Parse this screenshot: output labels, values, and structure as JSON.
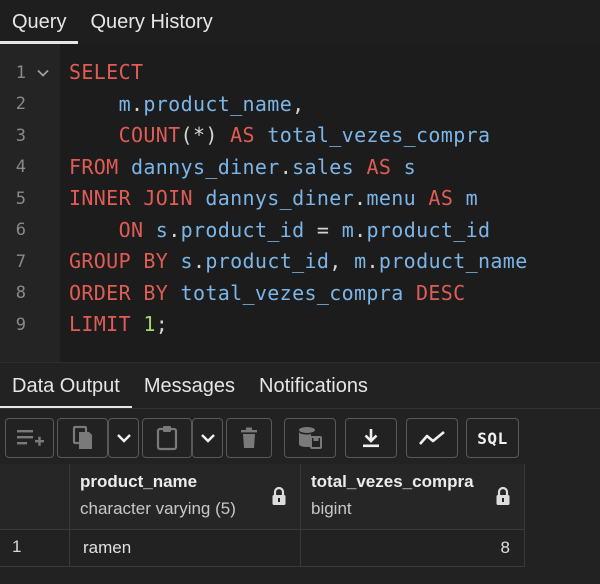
{
  "query_tabs": [
    {
      "label": "Query",
      "active": true
    },
    {
      "label": "Query History",
      "active": false
    }
  ],
  "editor": {
    "line_numbers": [
      "1",
      "2",
      "3",
      "4",
      "5",
      "6",
      "7",
      "8",
      "9"
    ],
    "lines": [
      [
        {
          "t": "SELECT",
          "c": "kw"
        }
      ],
      [
        {
          "t": "    ",
          "c": "op"
        },
        {
          "t": "m",
          "c": "id"
        },
        {
          "t": ".",
          "c": "op"
        },
        {
          "t": "product_name",
          "c": "id"
        },
        {
          "t": ",",
          "c": "op"
        }
      ],
      [
        {
          "t": "    ",
          "c": "op"
        },
        {
          "t": "COUNT",
          "c": "kw"
        },
        {
          "t": "(*) ",
          "c": "op"
        },
        {
          "t": "AS",
          "c": "kw"
        },
        {
          "t": " ",
          "c": "op"
        },
        {
          "t": "total_vezes_compra",
          "c": "id"
        }
      ],
      [
        {
          "t": "FROM",
          "c": "kw"
        },
        {
          "t": " ",
          "c": "op"
        },
        {
          "t": "dannys_diner",
          "c": "id"
        },
        {
          "t": ".",
          "c": "op"
        },
        {
          "t": "sales",
          "c": "id"
        },
        {
          "t": " ",
          "c": "op"
        },
        {
          "t": "AS",
          "c": "kw"
        },
        {
          "t": " ",
          "c": "op"
        },
        {
          "t": "s",
          "c": "id"
        }
      ],
      [
        {
          "t": "INNER JOIN",
          "c": "kw"
        },
        {
          "t": " ",
          "c": "op"
        },
        {
          "t": "dannys_diner",
          "c": "id"
        },
        {
          "t": ".",
          "c": "op"
        },
        {
          "t": "menu",
          "c": "id"
        },
        {
          "t": " ",
          "c": "op"
        },
        {
          "t": "AS",
          "c": "kw"
        },
        {
          "t": " ",
          "c": "op"
        },
        {
          "t": "m",
          "c": "id"
        }
      ],
      [
        {
          "t": "    ",
          "c": "op"
        },
        {
          "t": "ON",
          "c": "kw"
        },
        {
          "t": " ",
          "c": "op"
        },
        {
          "t": "s",
          "c": "id"
        },
        {
          "t": ".",
          "c": "op"
        },
        {
          "t": "product_id",
          "c": "id"
        },
        {
          "t": " = ",
          "c": "op"
        },
        {
          "t": "m",
          "c": "id"
        },
        {
          "t": ".",
          "c": "op"
        },
        {
          "t": "product_id",
          "c": "id"
        }
      ],
      [
        {
          "t": "GROUP BY",
          "c": "kw"
        },
        {
          "t": " ",
          "c": "op"
        },
        {
          "t": "s",
          "c": "id"
        },
        {
          "t": ".",
          "c": "op"
        },
        {
          "t": "product_id",
          "c": "id"
        },
        {
          "t": ", ",
          "c": "op"
        },
        {
          "t": "m",
          "c": "id"
        },
        {
          "t": ".",
          "c": "op"
        },
        {
          "t": "product_name",
          "c": "id"
        }
      ],
      [
        {
          "t": "ORDER BY",
          "c": "kw"
        },
        {
          "t": " ",
          "c": "op"
        },
        {
          "t": "total_vezes_compra",
          "c": "id"
        },
        {
          "t": " ",
          "c": "op"
        },
        {
          "t": "DESC",
          "c": "kw"
        }
      ],
      [
        {
          "t": "LIMIT",
          "c": "kw"
        },
        {
          "t": " ",
          "c": "op"
        },
        {
          "t": "1",
          "c": "num-lit"
        },
        {
          "t": ";",
          "c": "op"
        }
      ]
    ]
  },
  "output_tabs": [
    {
      "label": "Data Output",
      "active": true
    },
    {
      "label": "Messages",
      "active": false
    },
    {
      "label": "Notifications",
      "active": false
    }
  ],
  "toolbar": {
    "sql_label": "SQL",
    "icons": [
      "add-row-icon",
      "copy-icon",
      "dropdown-chevron-icon",
      "paste-icon",
      "dropdown-chevron-icon",
      "delete-icon",
      "save-data-icon",
      "download-icon",
      "graph-visualiser-icon",
      "sql-view-icon"
    ]
  },
  "grid": {
    "columns": [
      {
        "name": "product_name",
        "type": "character varying (5)"
      },
      {
        "name": "total_vezes_compra",
        "type": "bigint"
      }
    ],
    "rows": [
      {
        "num": "1",
        "cells": [
          "ramen",
          "8"
        ]
      }
    ]
  },
  "colors": {
    "keyword": "#e05c55",
    "identifier": "#7cb5e8",
    "number": "#a8d36e",
    "background": "#222222"
  }
}
